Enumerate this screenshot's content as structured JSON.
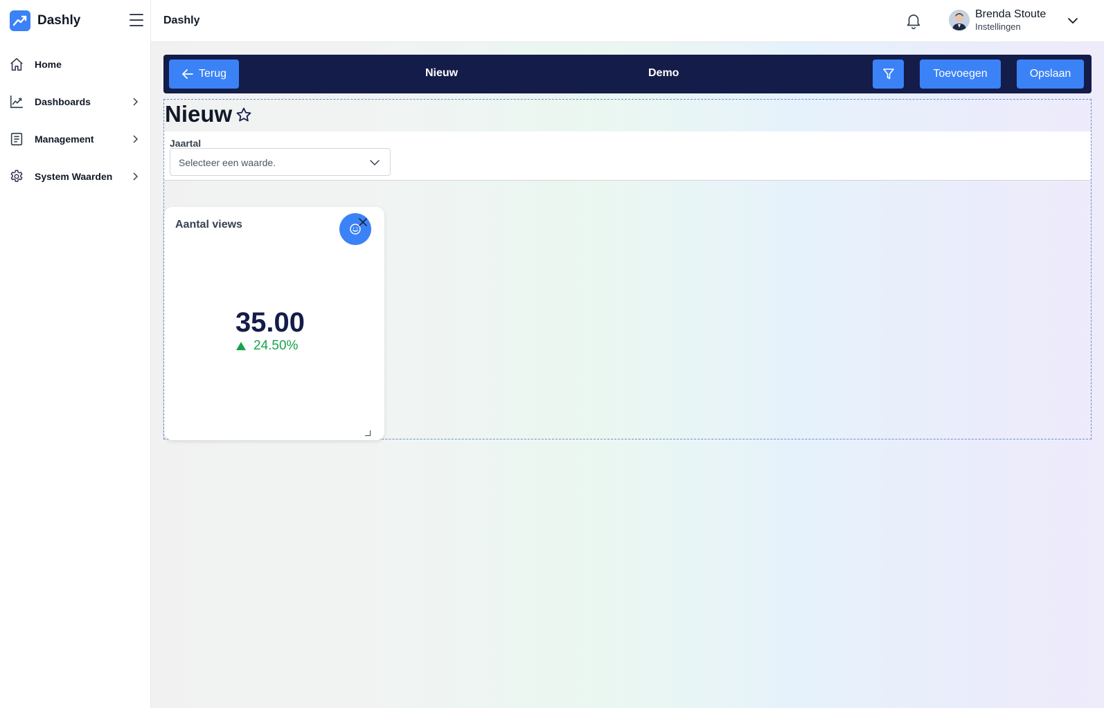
{
  "app": {
    "name": "Dashly",
    "brand_color": "#3b82f6"
  },
  "sidebar": {
    "items": [
      {
        "label": "Home",
        "icon": "home-icon"
      },
      {
        "label": "Dashboards",
        "icon": "line-chart-icon"
      },
      {
        "label": "Management",
        "icon": "document-icon"
      },
      {
        "label": "System Waarden",
        "icon": "gear-icon"
      }
    ]
  },
  "header": {
    "title": "Dashly",
    "user": {
      "name": "Brenda Stoute",
      "subtitle": "Instellingen"
    }
  },
  "toolbar": {
    "back_label": "Terug",
    "dashboard_name": "Nieuw",
    "project_name": "Demo",
    "add_label": "Toevoegen",
    "save_label": "Opslaan",
    "background": "#141c4a"
  },
  "page": {
    "title": "Nieuw"
  },
  "filter": {
    "label": "Jaartal",
    "placeholder": "Selecteer een waarde."
  },
  "widget": {
    "title": "Aantal views",
    "value": "35.00",
    "change": "24.50%",
    "change_direction": "up",
    "change_color": "#16a34a"
  }
}
